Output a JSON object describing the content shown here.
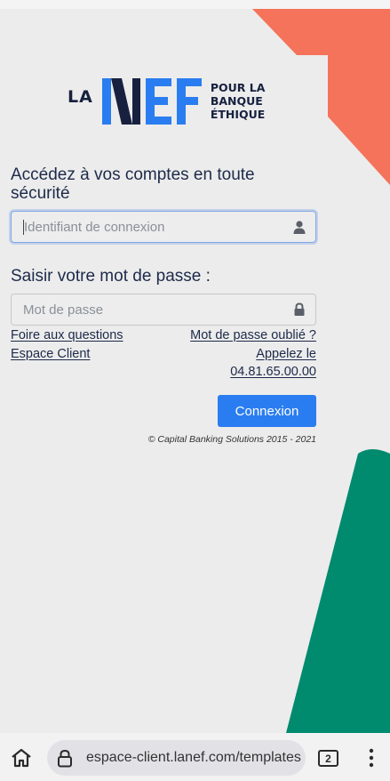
{
  "logo": {
    "la": "LA",
    "nef_alt": "NEF",
    "tagline_line1": "POUR LA",
    "tagline_line2": "BANQUE",
    "tagline_line3": "ÉTHIQUE"
  },
  "login": {
    "heading": "Accédez à vos comptes en toute sécurité",
    "login_placeholder": "Identifiant de connexion",
    "password_label": "Saisir votre mot de passe :",
    "password_placeholder": "Mot de passe",
    "links": {
      "faq": "Foire aux questions",
      "client_area": "Espace Client",
      "forgot_password": "Mot de passe oublié ?",
      "call": "Appelez le",
      "phone": "04.81.65.00.00"
    },
    "connect_label": "Connexion",
    "copyright": "© Capital Banking Solutions 2015 - 2021"
  },
  "browser": {
    "url": "espace-client.lanef.com/templates",
    "tab_count": "2",
    "icons": [
      "home-icon",
      "lock-icon",
      "tabs-icon",
      "more-vert-icon",
      "user-icon",
      "padlock-icon"
    ]
  },
  "colors": {
    "accent_blue": "#2a7df0",
    "deco_orange": "#f4735a",
    "deco_green": "#008a6e",
    "navy": "#17213f"
  }
}
